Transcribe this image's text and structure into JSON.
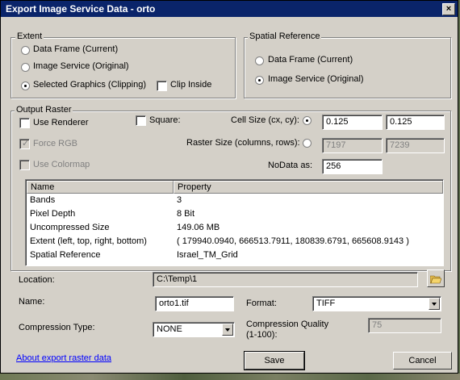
{
  "window": {
    "title": "Export Image Service Data - orto",
    "close_glyph": "×"
  },
  "extent": {
    "title": "Extent",
    "options": [
      "Data Frame (Current)",
      "Image Service (Original)",
      "Selected Graphics (Clipping)"
    ],
    "selected_index": 2,
    "clip_inside_label": "Clip Inside"
  },
  "spatial_reference": {
    "title": "Spatial Reference",
    "options": [
      "Data Frame (Current)",
      "Image Service (Original)"
    ],
    "selected_index": 1
  },
  "output_raster": {
    "title": "Output Raster",
    "use_renderer_label": "Use Renderer",
    "force_rgb_label": "Force RGB",
    "use_colormap_label": "Use Colormap",
    "square_label": "Square:",
    "cell_size_label": "Cell Size (cx, cy):",
    "cell_size_x": "0.125",
    "cell_size_y": "0.125",
    "raster_size_label": "Raster Size (columns, rows):",
    "raster_columns": "7197",
    "raster_rows": "7239",
    "nodata_label": "NoData as:",
    "nodata_value": "256"
  },
  "properties": {
    "headers": [
      "Name",
      "Property"
    ],
    "rows": [
      [
        "Bands",
        "3"
      ],
      [
        "Pixel Depth",
        "8 Bit"
      ],
      [
        "Uncompressed Size",
        "149.06 MB"
      ],
      [
        "Extent (left, top, right, bottom)",
        "( 179940.0940, 666513.7911, 180839.6791, 665608.9143 )"
      ],
      [
        "Spatial Reference",
        "Israel_TM_Grid"
      ]
    ]
  },
  "location": {
    "label": "Location:",
    "value": "C:\\Temp\\1",
    "browse_icon": "folder-open-icon"
  },
  "name": {
    "label": "Name:",
    "value": "orto1.tif"
  },
  "format": {
    "label": "Format:",
    "value": "TIFF"
  },
  "compression": {
    "type_label": "Compression Type:",
    "type_value": "NONE",
    "quality_label_1": "Compression Quality",
    "quality_label_2": "(1-100):",
    "quality_value": "75"
  },
  "footer": {
    "about_link": "About export raster data",
    "save_label": "Save",
    "cancel_label": "Cancel"
  }
}
